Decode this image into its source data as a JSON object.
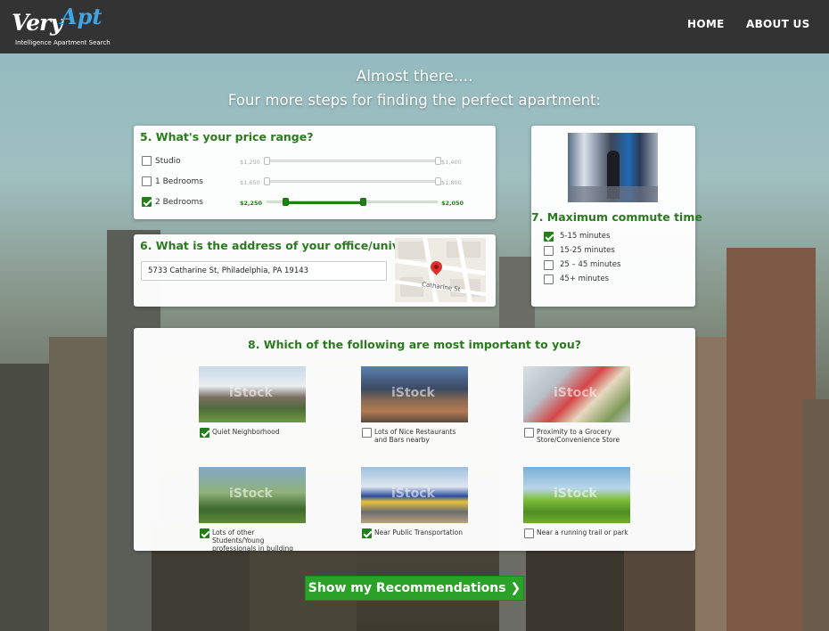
{
  "brand": {
    "name_a": "Very",
    "name_b": "Apt",
    "tagline": "Intelligence Apartment Search"
  },
  "nav": {
    "home": "HOME",
    "about": "ABOUT US"
  },
  "heading": {
    "line1": "Almost there....",
    "line2": "Four more steps for finding the perfect apartment:"
  },
  "price": {
    "question": "5. What's your price range?",
    "rows": [
      {
        "label": "Studio",
        "checked": false,
        "min": "$1,250",
        "max": "$1,400",
        "lo": 0.0,
        "hi": 1.0
      },
      {
        "label": "1 Bedrooms",
        "checked": false,
        "min": "$1,650",
        "max": "$1,800",
        "lo": 0.0,
        "hi": 1.0
      },
      {
        "label": "2 Bedrooms",
        "checked": true,
        "min": "$2,250",
        "max": "$2,050",
        "lo": 0.11,
        "hi": 0.56
      }
    ]
  },
  "address": {
    "question": "6. What is the address of your office/university?",
    "value": "5733 Catharine St, Philadelphia, PA 19143",
    "map_label": "Catharine St"
  },
  "commute": {
    "question": "7. Maximum commute time",
    "options": [
      {
        "label": "5-15 minutes",
        "checked": true
      },
      {
        "label": "15-25 minutes",
        "checked": false
      },
      {
        "label": "25 – 45 minutes",
        "checked": false
      },
      {
        "label": "45+ minutes",
        "checked": false
      }
    ]
  },
  "important": {
    "question": "8. Which of the following are most important to you?",
    "watermark": "iStock",
    "options": [
      {
        "label": "Quiet Neighborhood",
        "checked": true
      },
      {
        "label": "Lots of Nice Restaurants and Bars nearby",
        "checked": false
      },
      {
        "label": "Proximity to a Grocery Store/Convenience Store",
        "checked": false
      },
      {
        "label": "Lots of other Students/Young professionals in building",
        "checked": true
      },
      {
        "label": "Near Public Transportation",
        "checked": true
      },
      {
        "label": "Near a running trail or park",
        "checked": false
      }
    ]
  },
  "cta": {
    "label": "Show my Recommendations ❯"
  },
  "colors": {
    "accent": "#2a7a1e",
    "cta": "#2aa127",
    "topbar": "#333333",
    "logo_blue": "#3ea6e4"
  }
}
